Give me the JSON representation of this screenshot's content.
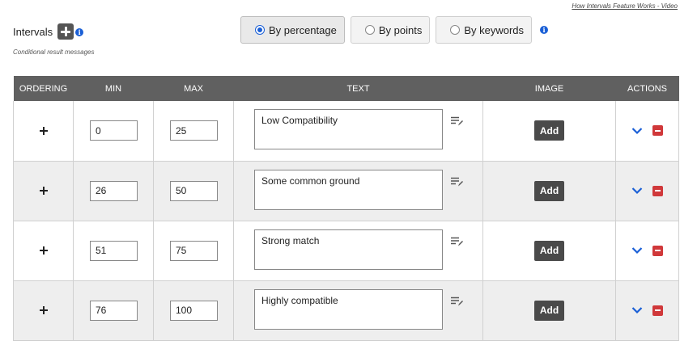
{
  "help_link": "How Intervals Feature Works - Video",
  "header": {
    "title": "Intervals",
    "subtitle": "Conditional result messages"
  },
  "modes": [
    {
      "label": "By percentage",
      "selected": true
    },
    {
      "label": "By points",
      "selected": false
    },
    {
      "label": "By keywords",
      "selected": false
    }
  ],
  "info_glyph": "i",
  "table": {
    "columns": {
      "ordering": "ORDERING",
      "min": "MIN",
      "max": "MAX",
      "text": "TEXT",
      "image": "IMAGE",
      "actions": "ACTIONS"
    },
    "add_label": "Add",
    "rows": [
      {
        "min": "0",
        "max": "25",
        "text": "Low Compatibility"
      },
      {
        "min": "26",
        "max": "50",
        "text": "Some common ground"
      },
      {
        "min": "51",
        "max": "75",
        "text": "Strong match"
      },
      {
        "min": "76",
        "max": "100",
        "text": "Highly compatible"
      }
    ]
  },
  "colors": {
    "header_bg": "#606060",
    "accent_blue": "#1a5fd6",
    "remove_red": "#d0383a",
    "row_alt_bg": "#eeeeee"
  },
  "icons": {
    "add": "plus-icon",
    "info": "info-icon",
    "drag": "move-arrows-icon",
    "edit": "edit-text-icon",
    "expand": "chevron-down-icon",
    "remove": "minus-icon"
  }
}
